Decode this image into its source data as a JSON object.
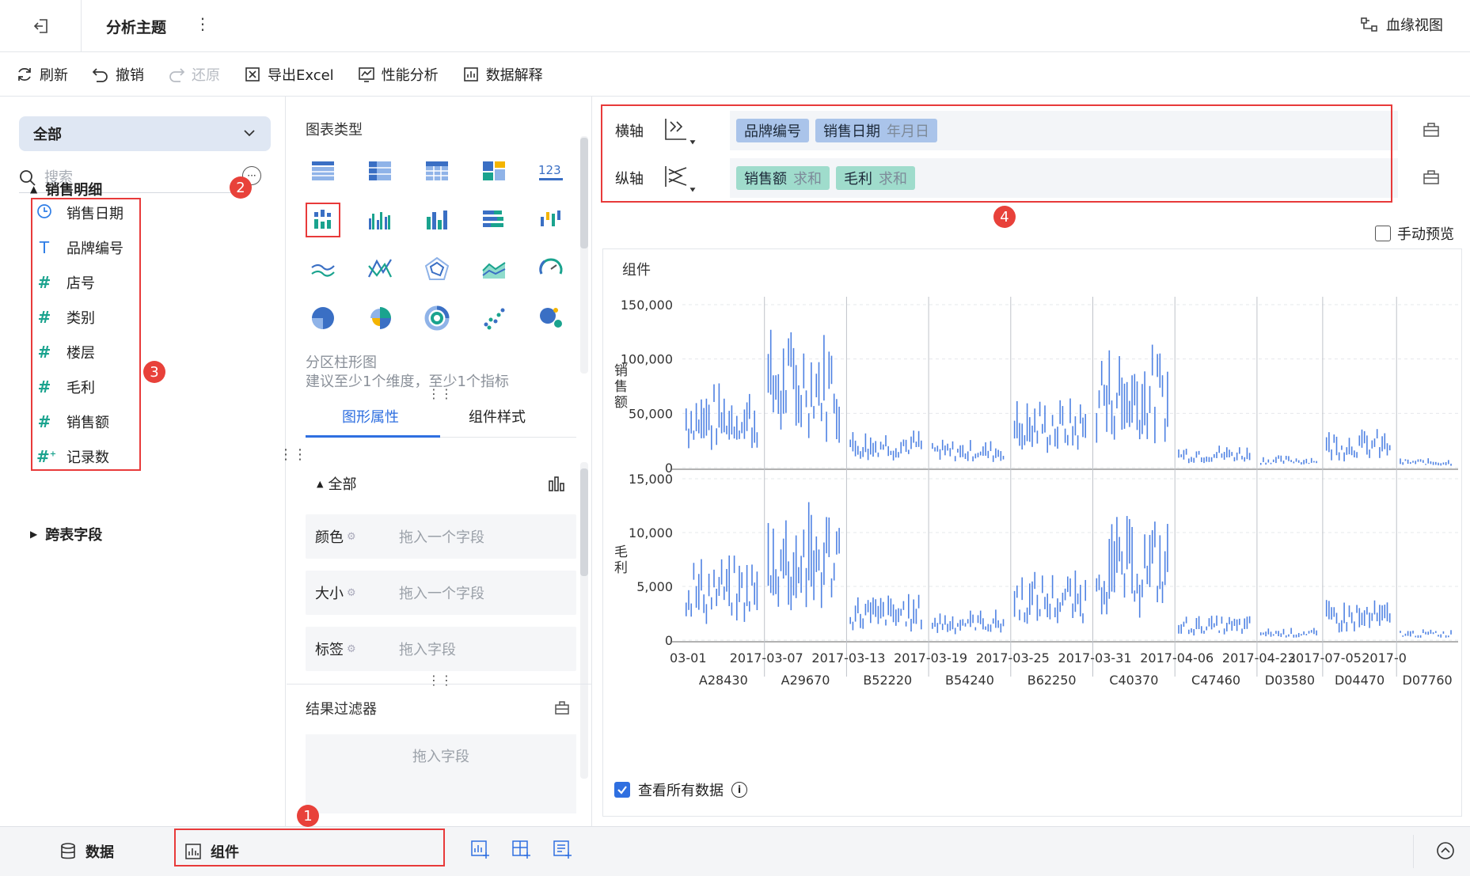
{
  "titlebar": {
    "title": "分析主题",
    "more": "⋮",
    "lineage_label": "血缘视图"
  },
  "toolbar": {
    "refresh": "刷新",
    "undo": "撤销",
    "redo": "还原",
    "export_excel": "导出Excel",
    "performance": "性能分析",
    "explain": "数据解释"
  },
  "left": {
    "dropdown_value": "全部",
    "search_placeholder": "搜索",
    "more_icon": "···",
    "group_label": "销售明细",
    "fields": [
      {
        "label": "销售日期",
        "icon": "clock-icon"
      },
      {
        "label": "品牌编号",
        "icon": "text-T-icon"
      },
      {
        "label": "店号",
        "icon": "hash-icon"
      },
      {
        "label": "类别",
        "icon": "hash-icon"
      },
      {
        "label": "楼层",
        "icon": "hash-icon"
      },
      {
        "label": "毛利",
        "icon": "hash-icon"
      },
      {
        "label": "销售额",
        "icon": "hash-icon"
      },
      {
        "label": "记录数",
        "icon": "hash-plus-icon"
      }
    ],
    "cross_table_label": "跨表字段"
  },
  "badges": {
    "b1": "1",
    "b2": "2",
    "b3": "3",
    "b4": "4"
  },
  "middle": {
    "chart_type_label": "图表类型",
    "selected_chart_name": "分区柱形图",
    "selected_chart_hint": "建议至少1个维度，至少1个指标",
    "tab_graph": "图形属性",
    "tab_style": "组件样式",
    "all_label": "全部",
    "props": [
      {
        "label": "颜色",
        "placeholder": "拖入一个字段"
      },
      {
        "label": "大小",
        "placeholder": "拖入一个字段"
      },
      {
        "label": "标签",
        "placeholder": "拖入字段"
      }
    ],
    "filter_label": "结果过滤器",
    "filter_placeholder": "拖入字段"
  },
  "axes": {
    "x_label": "横轴",
    "y_label": "纵轴",
    "x_fields": [
      {
        "name": "品牌编号",
        "sub": ""
      },
      {
        "name": "销售日期",
        "sub": "年月日"
      }
    ],
    "y_fields": [
      {
        "name": "销售额",
        "sub": "求和"
      },
      {
        "name": "毛利",
        "sub": "求和"
      }
    ],
    "manual_preview": "手动预览"
  },
  "chart_data": {
    "type": "bar",
    "title": "组件",
    "panels": [
      {
        "ylabel": "销售额",
        "ylim": [
          0,
          150000
        ],
        "ticks": [
          "150,000",
          "100,000",
          "50,000",
          "0"
        ]
      },
      {
        "ylabel": "毛利",
        "ylim": [
          0,
          15000
        ],
        "ticks": [
          "15,000",
          "10,000",
          "5,000",
          "0"
        ]
      }
    ],
    "date_ticks": [
      "03-01",
      "2017-03-07",
      "2017-03-13",
      "2017-03-19",
      "2017-03-25",
      "2017-03-31",
      "2017-04-06",
      "2017-04-23",
      "2017-07-05",
      "2017-0"
    ],
    "brands": [
      "A28430",
      "A29670",
      "B52220",
      "B54240",
      "B62250",
      "C40370",
      "C47460",
      "D03580",
      "D04470",
      "D07760"
    ],
    "brand_level_sales": [
      55000,
      90000,
      25000,
      18000,
      45000,
      80000,
      15000,
      8000,
      25000,
      6000
    ],
    "brand_level_profit": [
      5500,
      9000,
      3000,
      2000,
      4500,
      8000,
      1600,
      800,
      2600,
      700
    ],
    "grid": true
  },
  "view_all": "查看所有数据",
  "bottom": {
    "data_tab": "数据",
    "component_tab": "组件"
  }
}
